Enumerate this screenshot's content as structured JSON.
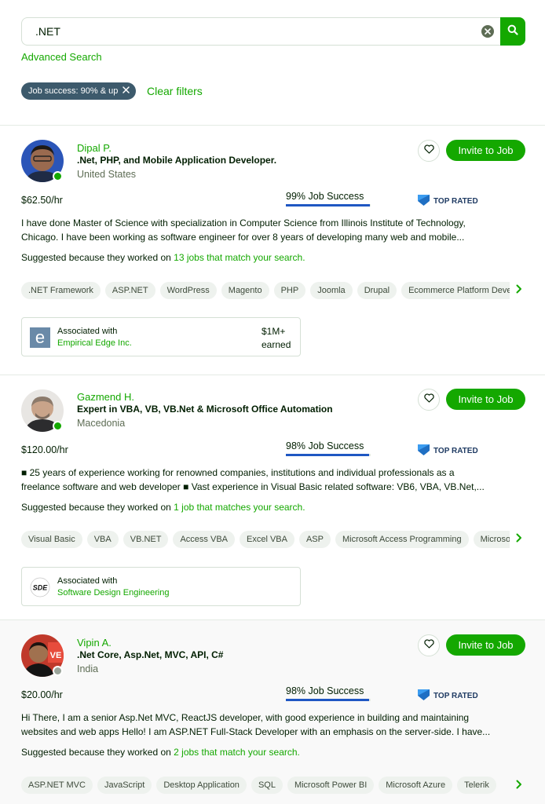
{
  "search": {
    "value": ".NET",
    "advanced_label": "Advanced Search"
  },
  "filters": {
    "chips": [
      {
        "label": "Job success: 90% & up"
      }
    ],
    "clear_label": "Clear filters"
  },
  "invite_label": "Invite to Job",
  "top_rated_label": "TOP RATED",
  "accent_color": "#14a800",
  "freelancers": [
    {
      "name": "Dipal P.",
      "title": ".Net, PHP, and Mobile Application Developer.",
      "location": "United States",
      "online": true,
      "rate": "$62.50/hr",
      "job_success": "99% Job Success",
      "job_success_value": 99,
      "description_lines": [
        "I have done Master of Science with specialization in Computer Science from Illinois Institute of Technology,",
        "Chicago. I have been working as software engineer for over 8 years of developing many web and mobile..."
      ],
      "suggested_prefix": "Suggested because they worked on ",
      "suggested_link": "13 jobs that match your search.",
      "skills": [
        ".NET Framework",
        "ASP.NET",
        "WordPress",
        "Magento",
        "PHP",
        "Joomla",
        "Drupal",
        "Ecommerce Platform Development"
      ],
      "agency": {
        "with_label": "Associated with",
        "name": "Empirical Edge Inc.",
        "earned_amount": "$1M+",
        "earned_label": "earned"
      }
    },
    {
      "name": "Gazmend H.",
      "title": "Expert in VBA, VB, VB.Net & Microsoft Office Automation",
      "location": "Macedonia",
      "online": true,
      "rate": "$120.00/hr",
      "job_success": "98% Job Success",
      "job_success_value": 98,
      "description_lines": [
        "■ 25 years of experience working for renowned companies, institutions and individual professionals as a",
        "freelance software and web developer ■ Vast experience in Visual Basic related software: VB6, VBA, VB.Net,..."
      ],
      "suggested_prefix": "Suggested because they worked on ",
      "suggested_link": "1 job that matches your search.",
      "skills": [
        "Visual Basic",
        "VBA",
        "VB.NET",
        "Access VBA",
        "Excel VBA",
        "ASP",
        "Microsoft Access Programming",
        "Microsoft Excel"
      ],
      "agency": {
        "with_label": "Associated with",
        "name": "Software Design Engineering",
        "logo_text": "SDE"
      }
    },
    {
      "name": "Vipin A.",
      "title": ".Net Core, Asp.Net, MVC, API, C#",
      "location": "India",
      "online": false,
      "rate": "$20.00/hr",
      "job_success": "98% Job Success",
      "job_success_value": 98,
      "description_lines": [
        "Hi There, I am a senior Asp.Net MVC, ReactJS developer, with good experience in building and maintaining",
        "websites and web apps Hello! I am ASP.NET Full-Stack Developer with an emphasis on the server-side. I have..."
      ],
      "suggested_prefix": "Suggested because they worked on ",
      "suggested_link": "2 jobs that match your search.",
      "skills": [
        "ASP.NET MVC",
        "JavaScript",
        "Desktop Application",
        "SQL",
        "Microsoft Power BI",
        "Microsoft Azure",
        "Telerik"
      ]
    }
  ]
}
